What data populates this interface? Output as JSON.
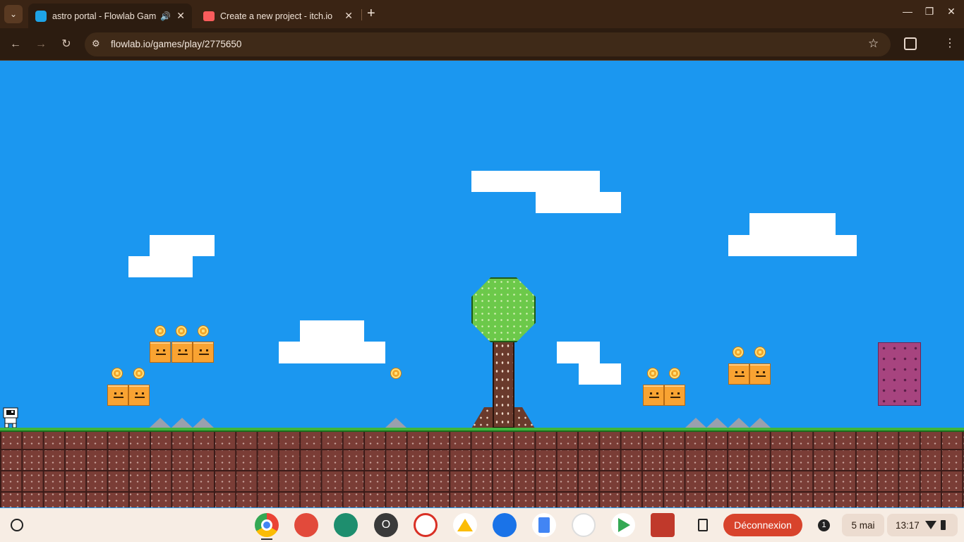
{
  "browser": {
    "tabs": [
      {
        "title": "astro portal - Flowlab Game",
        "active": true
      },
      {
        "title": "Create a new project - itch.io",
        "active": false
      }
    ],
    "url": "flowlab.io/games/play/2775650",
    "tab_list_icon": "chevron-down-icon",
    "new_tab_icon": "plus-icon",
    "colors": {
      "frame": "#3a2414",
      "toolbar": "#2c1c10"
    }
  },
  "game": {
    "sky_color": "#1b97f0",
    "ground_color": "#7a3d36",
    "grass_color": "#41b53c"
  },
  "taskbar": {
    "launcher_icon": "circle-launcher-icon",
    "apps": [
      "chrome-icon",
      "canvas-icon",
      "classroom-icon",
      "opera-icon",
      "screencast-icon",
      "drive-icon",
      "files-icon",
      "docs-icon",
      "photos-icon",
      "play-store-icon",
      "bookshelf-icon"
    ],
    "logout_label": "Déconnexion",
    "notification_count": "1",
    "date": "5 mai",
    "time": "13:17"
  }
}
